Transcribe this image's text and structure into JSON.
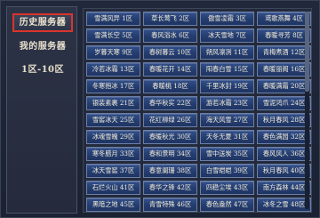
{
  "sidebar": {
    "items": [
      {
        "label": "历史服务器",
        "active": true
      },
      {
        "label": "我的服务器",
        "active": false
      },
      {
        "label": "1区-10区",
        "active": false
      }
    ]
  },
  "servers": [
    "雪满风异 1区",
    "草长莺飞 2区",
    "傲雪凌霜 3区",
    "鸢歌燕舞 4区",
    "雪满长空 5区",
    "春风浴水 6区",
    "冰天雪地 7区",
    "春暖寻芳 8区",
    "岁暮天寒 9区",
    "春树暮云 10区",
    "朔风凛冽 11区",
    "青梅煮酒 12区",
    "冷若冰霜 13区",
    "春暖花开 14区",
    "阳春白雪 15区",
    "春暖丽阁 16区",
    "冬寒抱冰 17区",
    "春暖桃 18区",
    "千里冰封 19区",
    "春暖满霜 20区",
    "银装素裹 21区",
    "春华秋实 22区",
    "游若冰霜 23区",
    "雪泥鸿爪 24区",
    "雪窖冰天 25区",
    "花红柳绿 26区",
    "海天风雪 27区",
    "秋月春风 28区",
    "冰魂雪魄 29区",
    "春暖秋光 30区",
    "天冬无夏 31区",
    "春色满园 32区",
    "寒冬腊月 33区",
    "春和景明 34区",
    "雪中送炭 35区",
    "春风风人 36区",
    "冰天雪窖 37区",
    "春意阑珊 38区",
    "白雪皑皑 39区",
    "秋月春风 40区",
    "石烂火山 41区",
    "春华之锋 42区",
    "四稳尘埃 43区",
    "南方森林 44区",
    "黑暗之地 45区",
    "青雪特殊 46区",
    "春色盎然 47区",
    "冰冬之雪 48区"
  ]
}
